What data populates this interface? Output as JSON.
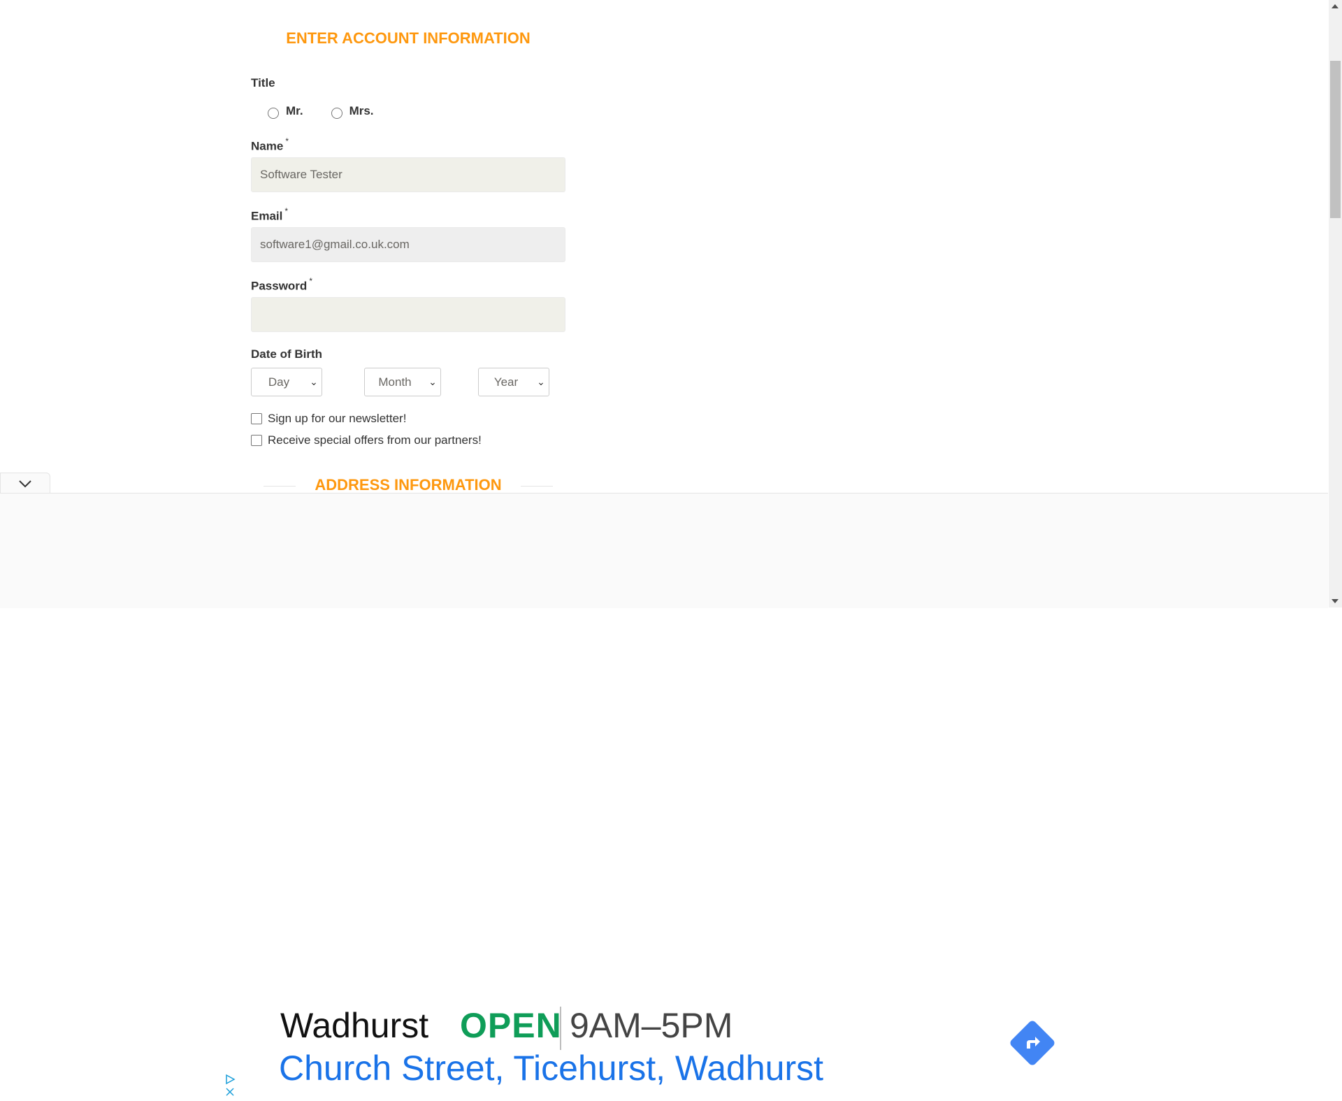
{
  "form": {
    "account_heading": "ENTER ACCOUNT INFORMATION",
    "title_label": "Title",
    "title_options": [
      "Mr.",
      "Mrs."
    ],
    "name_label": "Name",
    "name_value": "Software Tester",
    "email_label": "Email",
    "email_value": "software1@gmail.co.uk.com",
    "password_label": "Password",
    "password_value": "",
    "required_mark": "*",
    "dob_label": "Date of Birth",
    "dob_day": "Day",
    "dob_month": "Month",
    "dob_year": "Year",
    "newsletter_label": "Sign up for our newsletter!",
    "offers_label": "Receive special offers from our partners!",
    "address_heading": "ADDRESS INFORMATION"
  },
  "ad": {
    "name": "Wadhurst",
    "status": "OPEN",
    "hours": "9AM–5PM",
    "address": "Church Street, Ticehurst, Wadhurst"
  },
  "colors": {
    "heading": "#FE980F",
    "input_bg": "#F0F0E9",
    "open_green": "#0f9d58",
    "link_blue": "#1a73e8",
    "directions_blue": "#4285f4"
  }
}
